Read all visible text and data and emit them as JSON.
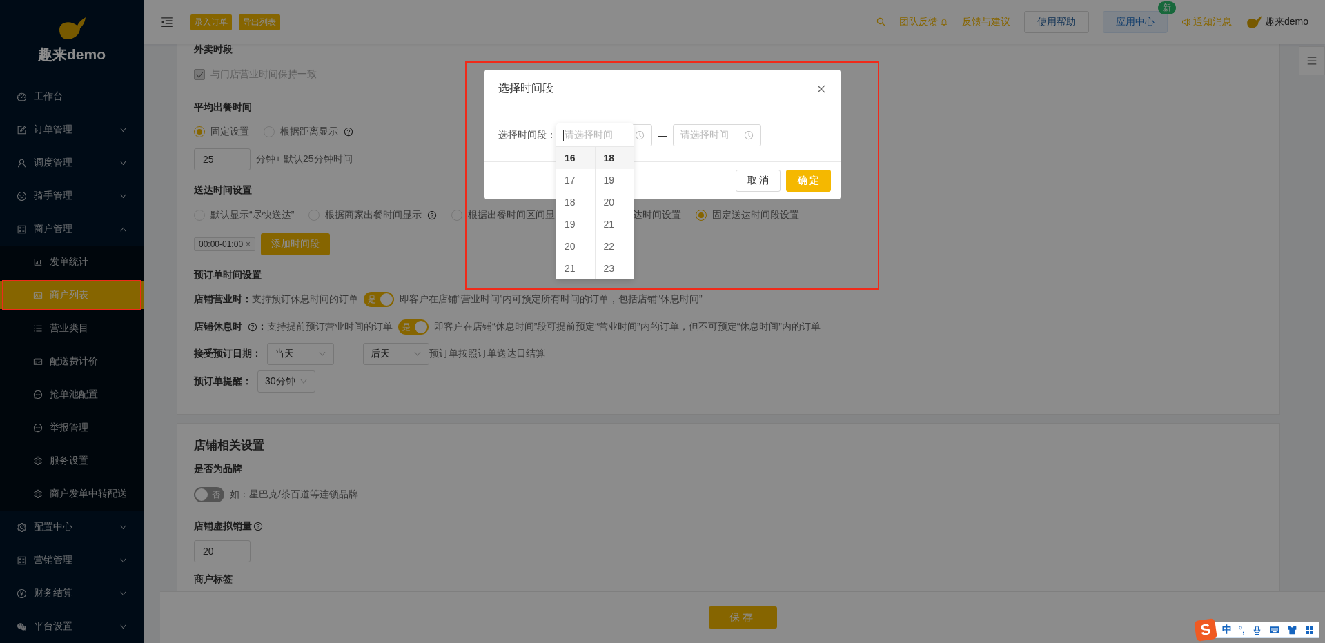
{
  "sidebar": {
    "brand": "趣来demo",
    "items": [
      {
        "label": "工作台"
      },
      {
        "label": "订单管理",
        "expanded": false
      },
      {
        "label": "调度管理",
        "expanded": false
      },
      {
        "label": "骑手管理",
        "expanded": false
      },
      {
        "label": "商户管理",
        "expanded": true,
        "children": [
          {
            "label": "发单统计",
            "selected": false
          },
          {
            "label": "商户列表",
            "selected": true
          },
          {
            "label": "营业类目",
            "selected": false
          },
          {
            "label": "配送费计价",
            "selected": false
          },
          {
            "label": "抢单池配置",
            "selected": false
          },
          {
            "label": "举报管理",
            "selected": false
          },
          {
            "label": "服务设置",
            "selected": false
          },
          {
            "label": "商户发单中转配送",
            "selected": false
          }
        ]
      },
      {
        "label": "配置中心",
        "expanded": false
      },
      {
        "label": "营销管理",
        "expanded": false
      },
      {
        "label": "财务结算",
        "expanded": false
      },
      {
        "label": "平台设置",
        "expanded": false
      }
    ]
  },
  "topbar": {
    "actions": [
      "录入订单",
      "导出列表"
    ],
    "team_feedback": "团队反馈",
    "feedback": "反馈与建议",
    "help": "使用帮助",
    "app_center": {
      "label": "应用中心",
      "badge": "新"
    },
    "notifications": "通知消息",
    "user": "趣来demo"
  },
  "takeout_period": {
    "title": "外卖时段",
    "checkbox": {
      "label": "与门店营业时间保持一致",
      "checked": true,
      "disabled": true
    }
  },
  "prep_time": {
    "title": "平均出餐时间",
    "options": [
      {
        "label": "固定设置",
        "selected": true,
        "help": false
      },
      {
        "label": "根据距离显示",
        "selected": false,
        "help": true
      }
    ],
    "value": "25",
    "suffix": "分钟+ 默认25分钟时间"
  },
  "delivery_time": {
    "title": "送达时间设置",
    "options": [
      {
        "kind": "radio",
        "label": "默认显示“尽快送达”",
        "selected": false,
        "help": false
      },
      {
        "kind": "radio",
        "label": "根据商家出餐时间显示",
        "selected": false,
        "help": true
      },
      {
        "kind": "radio",
        "label": "根据出餐时间区间显",
        "selected": false,
        "help": false
      },
      {
        "kind": "cut",
        "label": "达时间设置"
      },
      {
        "kind": "radio",
        "label": "固定送达时间段设置",
        "selected": true,
        "help": false
      }
    ],
    "tags": [
      {
        "label": "00:00-01:00",
        "remove": "×"
      }
    ],
    "add_button": "添加时间段"
  },
  "preorder": {
    "title": "预订单时间设置",
    "rules": [
      {
        "label": "店铺营业时",
        "help": false,
        "colon": "：",
        "text": "支持预订休息时间的订单",
        "switch": {
          "on": true,
          "text": "是"
        },
        "note": "即客户在店铺“营业时间”内可预定所有时间的订单，包括店铺“休息时间”"
      },
      {
        "label": "店铺休息时",
        "help": true,
        "colon": "：",
        "text": "支持提前预订营业时间的订单",
        "switch": {
          "on": true,
          "text": "是"
        },
        "note": "即客户在店铺“休息时间”段可提前预定“营业时间”内的订单，但不可预定“休息时间”内的订单"
      }
    ],
    "date": {
      "label": "接受预订日期：",
      "from": "当天",
      "dash": "—",
      "to": "后天",
      "note": "预订单按照订单送达日结算"
    },
    "reminder": {
      "label": "预订单提醒：",
      "value": "30分钟"
    }
  },
  "store": {
    "title": "店铺相关设置",
    "brand": {
      "title": "是否为品牌",
      "switch": {
        "on": false,
        "text": "否"
      },
      "hint": "如：星巴克/茶百道等连锁品牌"
    },
    "virtual_sales": {
      "title": "店铺虚拟销量",
      "help": true,
      "value": "20"
    },
    "tags_title": "商户标签"
  },
  "save_button": "保存",
  "dialog": {
    "title": "选择时间段",
    "label": "选择时间段：",
    "dash": "—",
    "end": {
      "placeholder": "请选择时间"
    },
    "buttons": [
      {
        "label": "取 消",
        "kind": "default"
      },
      {
        "label": "确 定",
        "kind": "primary"
      }
    ]
  },
  "time_panel": {
    "placeholder": "请选择时间",
    "columns": [
      {
        "items": [
          {
            "label": "16",
            "selected": true
          },
          {
            "label": "17",
            "selected": false
          },
          {
            "label": "18",
            "selected": false
          },
          {
            "label": "19",
            "selected": false
          },
          {
            "label": "20",
            "selected": false
          },
          {
            "label": "21",
            "selected": false
          }
        ]
      },
      {
        "items": [
          {
            "label": "18",
            "selected": true
          },
          {
            "label": "19",
            "selected": false
          },
          {
            "label": "20",
            "selected": false
          },
          {
            "label": "21",
            "selected": false
          },
          {
            "label": "22",
            "selected": false
          },
          {
            "label": "23",
            "selected": false
          }
        ]
      }
    ]
  },
  "ime_bar": {
    "logo": "S",
    "mode": "中",
    "punct": "°,"
  }
}
